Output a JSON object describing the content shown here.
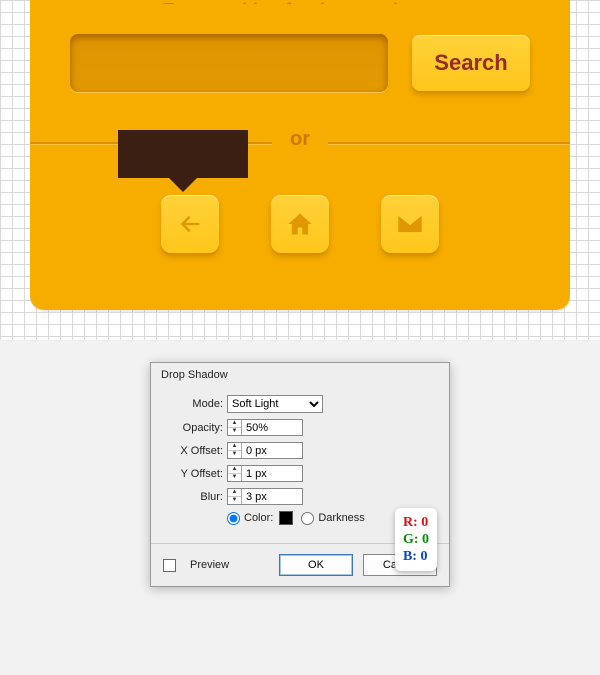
{
  "searchCard": {
    "prompt": "Try searching for the page here:",
    "searchPlaceholder": "",
    "searchButton": "Search",
    "orLabel": "or"
  },
  "dialog": {
    "title": "Drop Shadow",
    "labels": {
      "mode": "Mode:",
      "opacity": "Opacity:",
      "xoff": "X Offset:",
      "yoff": "Y Offset:",
      "blur": "Blur:",
      "color": "Color:",
      "darkness": "Darkness",
      "preview": "Preview",
      "ok": "OK",
      "cancel": "Cancel"
    },
    "values": {
      "mode": "Soft Light",
      "opacity": "50%",
      "xoff": "0 px",
      "yoff": "1 px",
      "blur": "3 px",
      "colorSwatch": "#000000",
      "colorSelected": true,
      "darknessSelected": false,
      "preview": false
    }
  },
  "rgb": {
    "r": "R: 0",
    "g": "G: 0",
    "b": "B: 0"
  }
}
